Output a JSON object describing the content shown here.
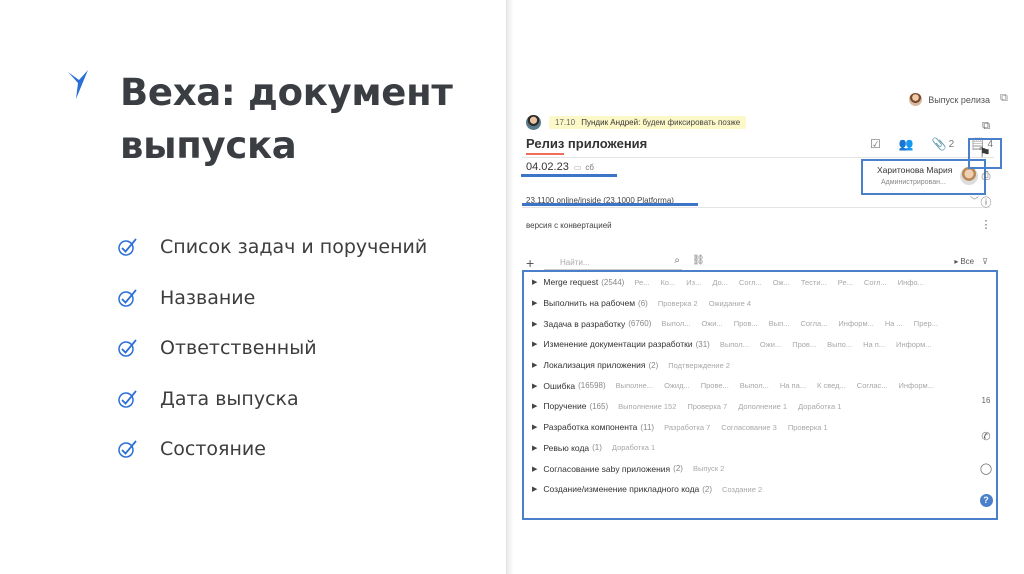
{
  "slide": {
    "title_line1": "Веха: документ",
    "title_line2": "выпуска",
    "bullets": [
      "Список задач и поручений",
      "Название",
      "Ответственный",
      "Дата выпуска",
      "Состояние"
    ],
    "colors": {
      "accent": "#2a6fd6",
      "title": "#3a3d42"
    }
  },
  "app": {
    "release_button": "Выпуск релиза",
    "comment": {
      "time": "17.10",
      "author": "Пундик Андрей:",
      "text": "будем фиксировать позже"
    },
    "doc_title": "Релиз приложения",
    "toolbar": {
      "attachments_count": "2",
      "notes_count": "4"
    },
    "date": "04.02.23",
    "weekday": "сб",
    "responsible": {
      "name": "Харитонова Мария",
      "role": "Администрирован..."
    },
    "version": "23.1100 online/inside (23.1000 Platforma)",
    "state": "версия с конвертацией",
    "search": {
      "placeholder": "Найти..."
    },
    "filter_all": "Все",
    "tasks": [
      {
        "name": "Merge request",
        "count": "(2544)",
        "sub": [
          "Ре...",
          "Ко...",
          "Из...",
          "До...",
          "Согл...",
          "Ож...",
          "Тести...",
          "Ре...",
          "Согл...",
          "Инфо..."
        ]
      },
      {
        "name": "Выполнить на рабочем",
        "count": "(6)",
        "sub": [
          "Проверка 2",
          "Ожидание 4"
        ]
      },
      {
        "name": "Задача в разработку",
        "count": "(6760)",
        "sub": [
          "Выпол...",
          "Ожи...",
          "Пров...",
          "Вып...",
          "Согла...",
          "Информ...",
          "На ...",
          "Прер..."
        ]
      },
      {
        "name": "Изменение документации разработки",
        "count": "(31)",
        "sub": [
          "Выпол...",
          "Ожи...",
          "Пров...",
          "Выпо...",
          "На п...",
          "Информ..."
        ]
      },
      {
        "name": "Локализация приложения",
        "count": "(2)",
        "sub": [
          "Подтверждение 2"
        ]
      },
      {
        "name": "Ошибка",
        "count": "(16598)",
        "sub": [
          "Выполне...",
          "Ожид...",
          "Прове...",
          "Выпол...",
          "На па...",
          "К свед...",
          "Соглас...",
          "Информ..."
        ]
      },
      {
        "name": "Поручение",
        "count": "(165)",
        "sub": [
          "Выполнение 152",
          "Проверка 7",
          "Дополнение 1",
          "Доработка 1"
        ]
      },
      {
        "name": "Разработка компонента",
        "count": "(11)",
        "sub": [
          "Разработка 7",
          "Согласование 3",
          "Проверка 1"
        ]
      },
      {
        "name": "Ревью кода",
        "count": "(1)",
        "sub": [
          "Доработка 1"
        ]
      },
      {
        "name": "Согласование saby приложения",
        "count": "(2)",
        "sub": [
          "Выпуск 2"
        ]
      },
      {
        "name": "Создание/изменение прикладного кода",
        "count": "(2)",
        "sub": [
          "Создание 2"
        ]
      }
    ],
    "sidebar": {
      "calendar_day": "16"
    },
    "colors": {
      "highlight": "#4a7fcc",
      "title_underline": "#f36b5a",
      "comment_bg": "#fdf8c8"
    }
  }
}
